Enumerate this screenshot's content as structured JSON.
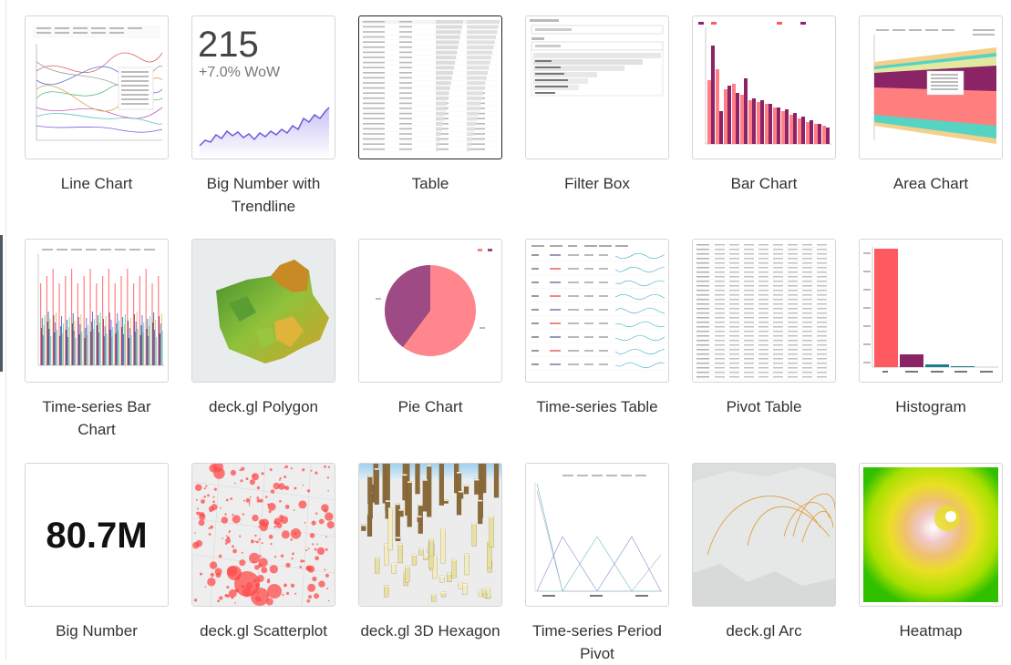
{
  "gallery": {
    "items": [
      {
        "label": "Line Chart"
      },
      {
        "label": "Big Number with Trendline",
        "thumb_number": "215",
        "thumb_delta": "+7.0% WoW"
      },
      {
        "label": "Table"
      },
      {
        "label": "Filter Box"
      },
      {
        "label": "Bar Chart"
      },
      {
        "label": "Area Chart"
      },
      {
        "label": "Time-series Bar Chart"
      },
      {
        "label": "deck.gl Polygon"
      },
      {
        "label": "Pie Chart"
      },
      {
        "label": "Time-series Table"
      },
      {
        "label": "Pivot Table"
      },
      {
        "label": "Histogram"
      },
      {
        "label": "Big Number",
        "thumb_number": "80.7M"
      },
      {
        "label": "deck.gl Scatterplot"
      },
      {
        "label": "deck.gl 3D Hexagon"
      },
      {
        "label": "Time-series Period Pivot"
      },
      {
        "label": "deck.gl Arc"
      },
      {
        "label": "Heatmap"
      }
    ],
    "selected_index": 2
  },
  "colors": {
    "card_border": "#d6d6d6",
    "selected_border": "#222222",
    "label_text": "#333333",
    "accent_red": "#ff5a5f",
    "accent_purple": "#8a2466"
  }
}
